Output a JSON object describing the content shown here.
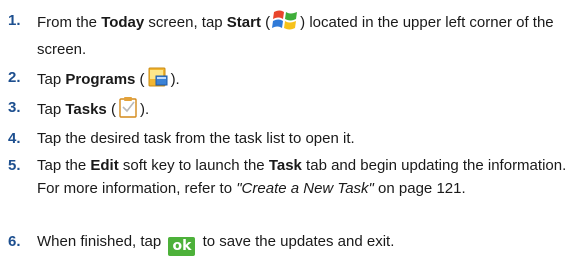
{
  "steps": [
    {
      "number": "1.",
      "t1": "From the ",
      "b1": "Today",
      "t2": " screen, tap ",
      "b2": "Start",
      "t3": " (",
      "icon": "windows-start-icon",
      "t4": ") located in the upper left corner of the screen."
    },
    {
      "number": "2.",
      "t1": "Tap ",
      "b1": "Programs",
      "t2": " (",
      "icon": "programs-folder-icon",
      "t3": ")."
    },
    {
      "number": "3.",
      "t1": "Tap ",
      "b1": "Tasks",
      "t2": " (",
      "icon": "tasks-clipboard-icon",
      "t3": ")."
    },
    {
      "number": "4.",
      "text": "Tap the desired task from the task list to open it."
    },
    {
      "number": "5.",
      "t1": "Tap the ",
      "b1": "Edit",
      "t2": " soft key to launch the ",
      "b2": "Task",
      "t3": " tab and begin updating the information. For more information, refer to ",
      "i1": "\"Create a New Task\"",
      "t4": "  on page 121."
    },
    {
      "number": "6.",
      "t1": "When finished, tap ",
      "ok": "ok",
      "t2": " to save the updates and exit."
    }
  ],
  "colors": {
    "number": "#1d4f8f",
    "ok_button": "#4db13a"
  }
}
